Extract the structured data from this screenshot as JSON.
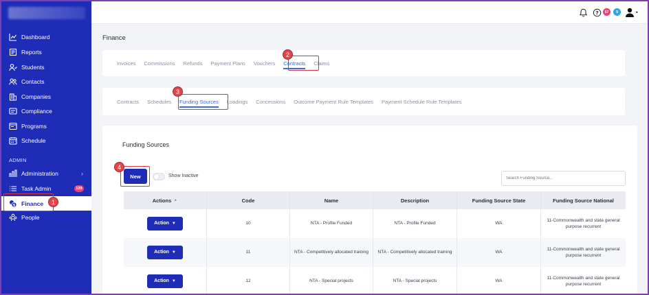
{
  "sidebar": {
    "items": [
      {
        "label": "Dashboard",
        "icon": "chart-line-icon"
      },
      {
        "label": "Reports",
        "icon": "report-icon"
      },
      {
        "label": "Students",
        "icon": "students-icon"
      },
      {
        "label": "Contacts",
        "icon": "contacts-icon"
      },
      {
        "label": "Companies",
        "icon": "companies-icon"
      },
      {
        "label": "Compliance",
        "icon": "compliance-icon"
      },
      {
        "label": "Programs",
        "icon": "programs-icon"
      },
      {
        "label": "Schedule",
        "icon": "schedule-icon"
      }
    ],
    "admin_label": "ADMIN",
    "admin_items": [
      {
        "label": "Administration",
        "icon": "administration-icon"
      },
      {
        "label": "Task Admin",
        "icon": "task-admin-icon",
        "badge": "129"
      },
      {
        "label": "Finance",
        "icon": "finance-icon"
      },
      {
        "label": "People",
        "icon": "people-icon"
      }
    ]
  },
  "topbar": {
    "badges": {
      "red": "57",
      "blue": "9"
    }
  },
  "page": {
    "title": "Finance"
  },
  "finance_tabs": [
    "Invoices",
    "Commissions",
    "Refunds",
    "Payment Plans",
    "Vouchers",
    "Contracts",
    "Claims"
  ],
  "contract_tabs": [
    "Contracts",
    "Schedules",
    "Funding Sources",
    "Loadings",
    "Concessions",
    "Outcome Payment Rule Templates",
    "Payment Schedule Rule Templates"
  ],
  "funding": {
    "section_title": "Funding Sources",
    "new_label": "New",
    "show_inactive": "Show Inactive",
    "search_placeholder": "Search Funding Source...",
    "columns": [
      "Actions",
      "Code",
      "Name",
      "Description",
      "Funding Source State",
      "Funding Source National"
    ],
    "action_label": "Action",
    "rows": [
      {
        "code": "10",
        "name": "NTA - Profile Funded",
        "description": "NTA - Profile Funded",
        "state": "WA",
        "national": "11-Commonwealth and state general purpose recurrent"
      },
      {
        "code": "11",
        "name": "NTA - Competitively allocated training",
        "description": "NTA - Competitively allocated training",
        "state": "WA",
        "national": "11-Commonwealth and state general purpose recurrent"
      },
      {
        "code": "12",
        "name": "NTA - Special projects",
        "description": "NTA - Special projects",
        "state": "WA",
        "national": "11-Commonwealth and state general purpose recurrent"
      }
    ]
  },
  "annotations": [
    "1",
    "2",
    "3",
    "4"
  ],
  "colors": {
    "sidebar": "#1e2cb8",
    "accent": "#3b6bd6",
    "annotation": "#d9363e"
  }
}
